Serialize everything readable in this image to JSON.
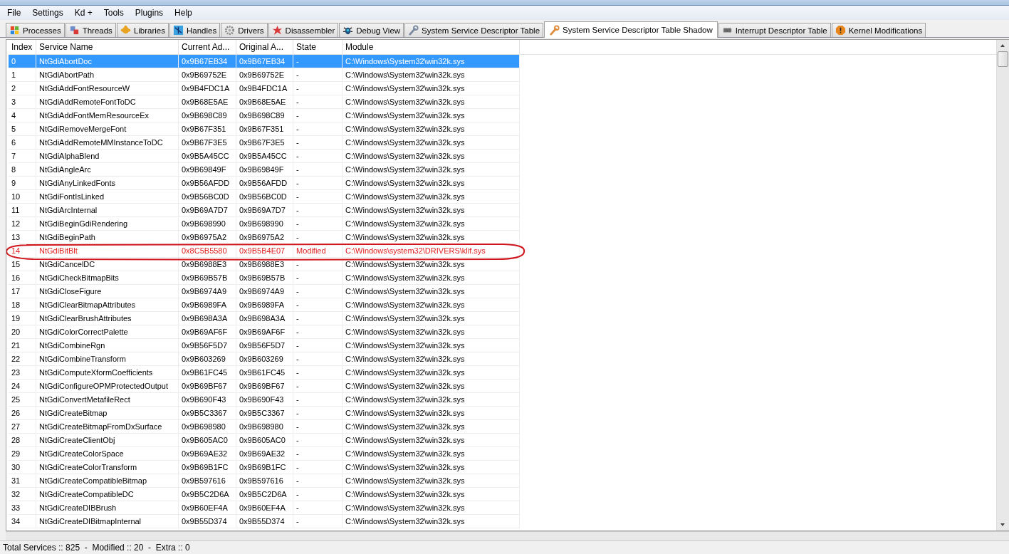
{
  "menu": [
    "File",
    "Settings",
    "Kd +",
    "Tools",
    "Plugins",
    "Help"
  ],
  "tabs": [
    {
      "label": "Processes",
      "selected": false
    },
    {
      "label": "Threads",
      "selected": false
    },
    {
      "label": "Libraries",
      "selected": false
    },
    {
      "label": "Handles",
      "selected": false
    },
    {
      "label": "Drivers",
      "selected": false
    },
    {
      "label": "Disassembler",
      "selected": false
    },
    {
      "label": "Debug View",
      "selected": false
    },
    {
      "label": "System Service Descriptor Table",
      "selected": false
    },
    {
      "label": "System Service Descriptor Table Shadow",
      "selected": true
    },
    {
      "label": "Interrupt Descriptor Table",
      "selected": false
    },
    {
      "label": "Kernel Modifications",
      "selected": false
    }
  ],
  "table": {
    "columns": [
      "Index",
      "Service Name",
      "Current Ad...",
      "Original A...",
      "State",
      "Module"
    ],
    "rows": [
      {
        "cells": [
          "0",
          "NtGdiAbortDoc",
          "0x9B67EB34",
          "0x9B67EB34",
          "-",
          "C:\\Windows\\System32\\win32k.sys"
        ],
        "selected": true,
        "modified": false
      },
      {
        "cells": [
          "1",
          "NtGdiAbortPath",
          "0x9B69752E",
          "0x9B69752E",
          "-",
          "C:\\Windows\\System32\\win32k.sys"
        ],
        "selected": false,
        "modified": false
      },
      {
        "cells": [
          "2",
          "NtGdiAddFontResourceW",
          "0x9B4FDC1A",
          "0x9B4FDC1A",
          "-",
          "C:\\Windows\\System32\\win32k.sys"
        ],
        "selected": false,
        "modified": false
      },
      {
        "cells": [
          "3",
          "NtGdiAddRemoteFontToDC",
          "0x9B68E5AE",
          "0x9B68E5AE",
          "-",
          "C:\\Windows\\System32\\win32k.sys"
        ],
        "selected": false,
        "modified": false
      },
      {
        "cells": [
          "4",
          "NtGdiAddFontMemResourceEx",
          "0x9B698C89",
          "0x9B698C89",
          "-",
          "C:\\Windows\\System32\\win32k.sys"
        ],
        "selected": false,
        "modified": false
      },
      {
        "cells": [
          "5",
          "NtGdiRemoveMergeFont",
          "0x9B67F351",
          "0x9B67F351",
          "-",
          "C:\\Windows\\System32\\win32k.sys"
        ],
        "selected": false,
        "modified": false
      },
      {
        "cells": [
          "6",
          "NtGdiAddRemoteMMInstanceToDC",
          "0x9B67F3E5",
          "0x9B67F3E5",
          "-",
          "C:\\Windows\\System32\\win32k.sys"
        ],
        "selected": false,
        "modified": false
      },
      {
        "cells": [
          "7",
          "NtGdiAlphaBlend",
          "0x9B5A45CC",
          "0x9B5A45CC",
          "-",
          "C:\\Windows\\System32\\win32k.sys"
        ],
        "selected": false,
        "modified": false
      },
      {
        "cells": [
          "8",
          "NtGdiAngleArc",
          "0x9B69849F",
          "0x9B69849F",
          "-",
          "C:\\Windows\\System32\\win32k.sys"
        ],
        "selected": false,
        "modified": false
      },
      {
        "cells": [
          "9",
          "NtGdiAnyLinkedFonts",
          "0x9B56AFDD",
          "0x9B56AFDD",
          "-",
          "C:\\Windows\\System32\\win32k.sys"
        ],
        "selected": false,
        "modified": false
      },
      {
        "cells": [
          "10",
          "NtGdiFontIsLinked",
          "0x9B56BC0D",
          "0x9B56BC0D",
          "-",
          "C:\\Windows\\System32\\win32k.sys"
        ],
        "selected": false,
        "modified": false
      },
      {
        "cells": [
          "11",
          "NtGdiArcInternal",
          "0x9B69A7D7",
          "0x9B69A7D7",
          "-",
          "C:\\Windows\\System32\\win32k.sys"
        ],
        "selected": false,
        "modified": false
      },
      {
        "cells": [
          "12",
          "NtGdiBeginGdiRendering",
          "0x9B698990",
          "0x9B698990",
          "-",
          "C:\\Windows\\System32\\win32k.sys"
        ],
        "selected": false,
        "modified": false
      },
      {
        "cells": [
          "13",
          "NtGdiBeginPath",
          "0x9B6975A2",
          "0x9B6975A2",
          "-",
          "C:\\Windows\\System32\\win32k.sys"
        ],
        "selected": false,
        "modified": false
      },
      {
        "cells": [
          "14",
          "NtGdiBitBlt",
          "0x8C5B5580",
          "0x9B5B4E07",
          "Modified",
          "C:\\Windows\\system32\\DRIVERS\\klif.sys"
        ],
        "selected": false,
        "modified": true
      },
      {
        "cells": [
          "15",
          "NtGdiCancelDC",
          "0x9B6988E3",
          "0x9B6988E3",
          "-",
          "C:\\Windows\\System32\\win32k.sys"
        ],
        "selected": false,
        "modified": false
      },
      {
        "cells": [
          "16",
          "NtGdiCheckBitmapBits",
          "0x9B69B57B",
          "0x9B69B57B",
          "-",
          "C:\\Windows\\System32\\win32k.sys"
        ],
        "selected": false,
        "modified": false
      },
      {
        "cells": [
          "17",
          "NtGdiCloseFigure",
          "0x9B6974A9",
          "0x9B6974A9",
          "-",
          "C:\\Windows\\System32\\win32k.sys"
        ],
        "selected": false,
        "modified": false
      },
      {
        "cells": [
          "18",
          "NtGdiClearBitmapAttributes",
          "0x9B6989FA",
          "0x9B6989FA",
          "-",
          "C:\\Windows\\System32\\win32k.sys"
        ],
        "selected": false,
        "modified": false
      },
      {
        "cells": [
          "19",
          "NtGdiClearBrushAttributes",
          "0x9B698A3A",
          "0x9B698A3A",
          "-",
          "C:\\Windows\\System32\\win32k.sys"
        ],
        "selected": false,
        "modified": false
      },
      {
        "cells": [
          "20",
          "NtGdiColorCorrectPalette",
          "0x9B69AF6F",
          "0x9B69AF6F",
          "-",
          "C:\\Windows\\System32\\win32k.sys"
        ],
        "selected": false,
        "modified": false
      },
      {
        "cells": [
          "21",
          "NtGdiCombineRgn",
          "0x9B56F5D7",
          "0x9B56F5D7",
          "-",
          "C:\\Windows\\System32\\win32k.sys"
        ],
        "selected": false,
        "modified": false
      },
      {
        "cells": [
          "22",
          "NtGdiCombineTransform",
          "0x9B603269",
          "0x9B603269",
          "-",
          "C:\\Windows\\System32\\win32k.sys"
        ],
        "selected": false,
        "modified": false
      },
      {
        "cells": [
          "23",
          "NtGdiComputeXformCoefficients",
          "0x9B61FC45",
          "0x9B61FC45",
          "-",
          "C:\\Windows\\System32\\win32k.sys"
        ],
        "selected": false,
        "modified": false
      },
      {
        "cells": [
          "24",
          "NtGdiConfigureOPMProtectedOutput",
          "0x9B69BF67",
          "0x9B69BF67",
          "-",
          "C:\\Windows\\System32\\win32k.sys"
        ],
        "selected": false,
        "modified": false
      },
      {
        "cells": [
          "25",
          "NtGdiConvertMetafileRect",
          "0x9B690F43",
          "0x9B690F43",
          "-",
          "C:\\Windows\\System32\\win32k.sys"
        ],
        "selected": false,
        "modified": false
      },
      {
        "cells": [
          "26",
          "NtGdiCreateBitmap",
          "0x9B5C3367",
          "0x9B5C3367",
          "-",
          "C:\\Windows\\System32\\win32k.sys"
        ],
        "selected": false,
        "modified": false
      },
      {
        "cells": [
          "27",
          "NtGdiCreateBitmapFromDxSurface",
          "0x9B698980",
          "0x9B698980",
          "-",
          "C:\\Windows\\System32\\win32k.sys"
        ],
        "selected": false,
        "modified": false
      },
      {
        "cells": [
          "28",
          "NtGdiCreateClientObj",
          "0x9B605AC0",
          "0x9B605AC0",
          "-",
          "C:\\Windows\\System32\\win32k.sys"
        ],
        "selected": false,
        "modified": false
      },
      {
        "cells": [
          "29",
          "NtGdiCreateColorSpace",
          "0x9B69AE32",
          "0x9B69AE32",
          "-",
          "C:\\Windows\\System32\\win32k.sys"
        ],
        "selected": false,
        "modified": false
      },
      {
        "cells": [
          "30",
          "NtGdiCreateColorTransform",
          "0x9B69B1FC",
          "0x9B69B1FC",
          "-",
          "C:\\Windows\\System32\\win32k.sys"
        ],
        "selected": false,
        "modified": false
      },
      {
        "cells": [
          "31",
          "NtGdiCreateCompatibleBitmap",
          "0x9B597616",
          "0x9B597616",
          "-",
          "C:\\Windows\\System32\\win32k.sys"
        ],
        "selected": false,
        "modified": false
      },
      {
        "cells": [
          "32",
          "NtGdiCreateCompatibleDC",
          "0x9B5C2D6A",
          "0x9B5C2D6A",
          "-",
          "C:\\Windows\\System32\\win32k.sys"
        ],
        "selected": false,
        "modified": false
      },
      {
        "cells": [
          "33",
          "NtGdiCreateDIBBrush",
          "0x9B60EF4A",
          "0x9B60EF4A",
          "-",
          "C:\\Windows\\System32\\win32k.sys"
        ],
        "selected": false,
        "modified": false
      },
      {
        "cells": [
          "34",
          "NtGdiCreateDIBitmapInternal",
          "0x9B55D374",
          "0x9B55D374",
          "-",
          "C:\\Windows\\System32\\win32k.sys"
        ],
        "selected": false,
        "modified": false
      }
    ]
  },
  "status_bar": "Total Services :: 825  -  Modified :: 20  -  Extra :: 0"
}
